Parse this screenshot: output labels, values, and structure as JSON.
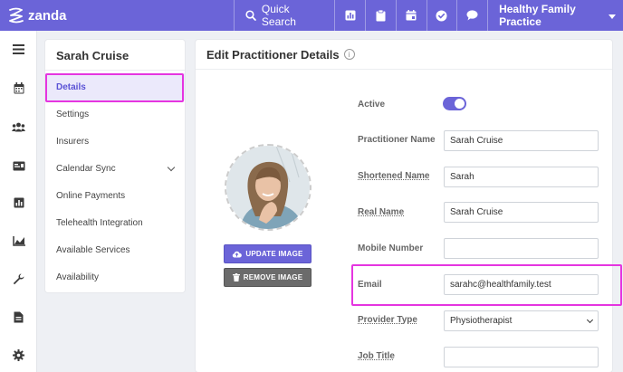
{
  "app": {
    "name": "zanda"
  },
  "topbar": {
    "search_label": "Quick Search",
    "practice_name": "Healthy Family Practice",
    "icons": [
      "chart-icon",
      "clipboard-icon",
      "calendar-add-icon",
      "check-circle-icon",
      "chat-icon"
    ]
  },
  "rail": {
    "icons": [
      "menu-icon",
      "calendar-icon",
      "users-icon",
      "id-card-icon",
      "bar-chart-icon",
      "line-chart-icon",
      "wrench-icon",
      "document-icon",
      "gear-icon"
    ]
  },
  "subnav": {
    "title": "Sarah Cruise",
    "items": [
      {
        "label": "Details"
      },
      {
        "label": "Settings"
      },
      {
        "label": "Insurers"
      },
      {
        "label": "Calendar Sync"
      },
      {
        "label": "Online Payments"
      },
      {
        "label": "Telehealth Integration"
      },
      {
        "label": "Available Services"
      },
      {
        "label": "Availability"
      }
    ]
  },
  "form": {
    "title": "Edit Practitioner Details",
    "update_image_label": "UPDATE IMAGE",
    "remove_image_label": "REMOVE IMAGE",
    "active_label": "Active",
    "active_value": true,
    "fields": {
      "practitioner_name": {
        "label": "Practitioner Name",
        "value": "Sarah Cruise"
      },
      "shortened_name": {
        "label": "Shortened Name",
        "value": "Sarah"
      },
      "real_name": {
        "label": "Real Name",
        "value": "Sarah Cruise"
      },
      "mobile_number": {
        "label": "Mobile Number",
        "value": ""
      },
      "email": {
        "label": "Email",
        "value": "sarahc@healthfamily.test"
      },
      "provider_type": {
        "label": "Provider Type",
        "value": "Physiotherapist"
      },
      "job_title": {
        "label": "Job Title",
        "value": ""
      }
    }
  },
  "colors": {
    "brand": "#6b64d8",
    "highlight": "#e535e0",
    "remove": "#6b6b6b"
  }
}
